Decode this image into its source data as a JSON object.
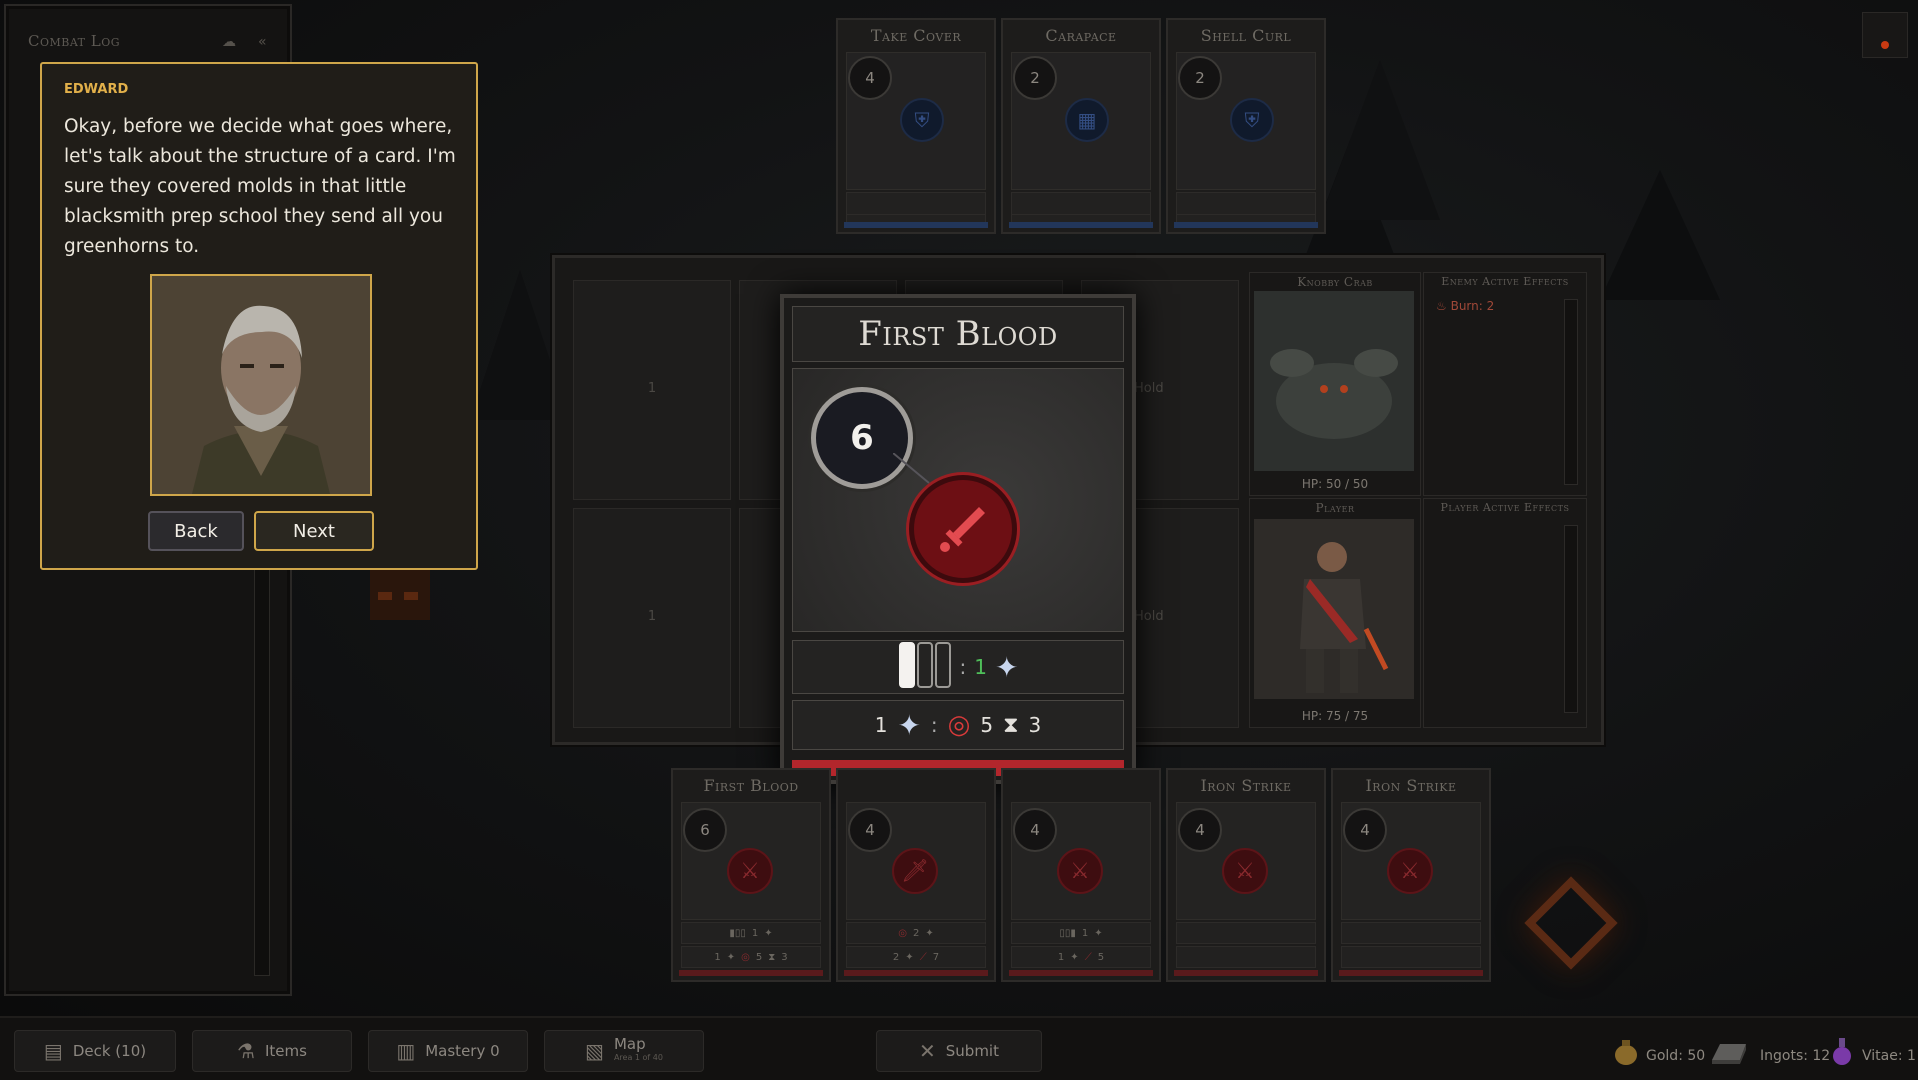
{
  "combat_log": {
    "title": "Combat Log",
    "icon_settings": "cloud-icon",
    "icon_collapse": "«"
  },
  "dialog": {
    "speaker": "EDWARD",
    "text": "Okay, before we decide what goes where, let's talk about the structure of a card. I'm sure they covered molds in that little blacksmith prep school they send all you greenhorns to.",
    "back_label": "Back",
    "next_label": "Next"
  },
  "enemy_cards": [
    {
      "name": "Take Cover",
      "cost": "4",
      "icon": "shield-icon"
    },
    {
      "name": "Carapace",
      "cost": "2",
      "icon": "armor-icon"
    },
    {
      "name": "Shell Curl",
      "cost": "2",
      "icon": "shield-icon"
    }
  ],
  "board": {
    "slot_numbers": [
      "1",
      "1"
    ],
    "hold_labels": [
      "Hold",
      "Hold"
    ],
    "enemy": {
      "name": "Knobby Crab",
      "hp": "HP: 50 / 50",
      "effects_title": "Enemy Active Effects",
      "effects": [
        {
          "label": "Burn: 2"
        }
      ]
    },
    "player": {
      "name": "Player",
      "hp": "HP: 75 / 75",
      "effects_title": "Player Active Effects"
    }
  },
  "focus_card": {
    "title": "First Blood",
    "cost": "6",
    "effect_icon": "sword-icon",
    "row1": {
      "separator": ":",
      "value": "1",
      "icon": "spark-icon"
    },
    "row2": {
      "count": "1",
      "separator": ":",
      "bleed": "5",
      "duration": "3"
    }
  },
  "hand": [
    {
      "name": "First Blood",
      "cost": "6",
      "stat1": "1",
      "stat2a": "1",
      "stat2b": "5",
      "stat2c": "3"
    },
    {
      "name": "",
      "cost": "4",
      "stat1": "2",
      "stat2a": "2",
      "stat2b": "7",
      "stat2c": ""
    },
    {
      "name": "",
      "cost": "4",
      "stat1": "1",
      "stat2a": "1",
      "stat2b": "5",
      "stat2c": ""
    },
    {
      "name": "Iron Strike",
      "cost": "4",
      "stat1": "",
      "stat2a": "",
      "stat2b": "",
      "stat2c": ""
    },
    {
      "name": "Iron Strike",
      "cost": "4",
      "stat1": "",
      "stat2a": "",
      "stat2b": "",
      "stat2c": ""
    }
  ],
  "bottom_bar": {
    "deck": "Deck (10)",
    "items": "Items",
    "mastery": "Mastery 0",
    "map": "Map",
    "map_sub": "Area 1 of 40",
    "submit": "Submit"
  },
  "resources": {
    "gold": "Gold: 50",
    "ingots": "Ingots: 12",
    "vitae": "Vitae: 1"
  },
  "colors": {
    "accent_gold": "#cfa64a",
    "attack_red": "#b3262c",
    "defense_blue": "#22365a"
  }
}
